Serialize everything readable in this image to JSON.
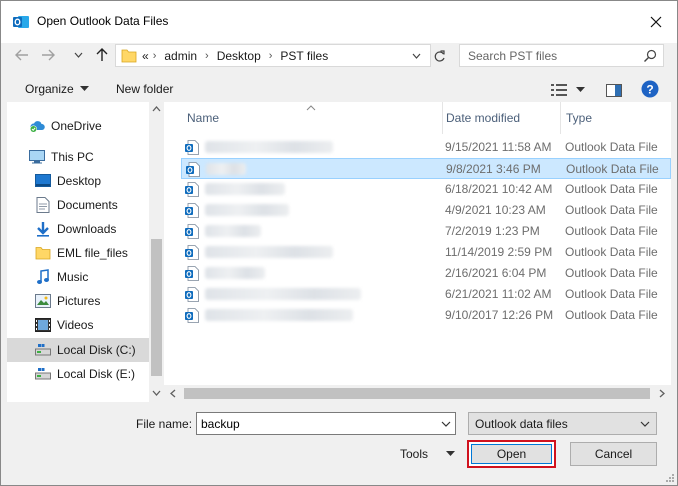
{
  "window": {
    "title": "Open Outlook Data Files",
    "app_icon": "outlook-icon",
    "close_icon": "close-icon"
  },
  "navigation": {
    "back_icon": "arrow-left-icon",
    "forward_icon": "arrow-right-icon",
    "recent_icon": "chevron-down-icon",
    "up_icon": "arrow-up-icon"
  },
  "addressbar": {
    "overflow": "«",
    "crumbs": [
      "admin",
      "Desktop",
      "PST files"
    ],
    "separator": "›"
  },
  "search": {
    "placeholder": "Search PST files",
    "icon": "search-icon"
  },
  "toolbar": {
    "organize_label": "Organize",
    "new_folder_label": "New folder",
    "view_icon": "details-view-icon",
    "preview_icon": "preview-pane-icon",
    "help_icon": "help-icon"
  },
  "sidebar": {
    "items": [
      {
        "label": "OneDrive",
        "icon": "onedrive-icon",
        "selected": false
      },
      {
        "label": "This PC",
        "icon": "computer-icon",
        "selected": false
      },
      {
        "label": "Desktop",
        "icon": "desktop-icon",
        "selected": false
      },
      {
        "label": "Documents",
        "icon": "documents-icon",
        "selected": false
      },
      {
        "label": "Downloads",
        "icon": "downloads-icon",
        "selected": false
      },
      {
        "label": "EML file_files",
        "icon": "folder-icon",
        "selected": false
      },
      {
        "label": "Music",
        "icon": "music-icon",
        "selected": false
      },
      {
        "label": "Pictures",
        "icon": "pictures-icon",
        "selected": false
      },
      {
        "label": "Videos",
        "icon": "videos-icon",
        "selected": false
      },
      {
        "label": "Local Disk (C:)",
        "icon": "drive-icon",
        "selected": true
      },
      {
        "label": "Local Disk (E:)",
        "icon": "drive-icon",
        "selected": false
      }
    ]
  },
  "filelist": {
    "columns": [
      "Name",
      "Date modified",
      "Type"
    ],
    "sort_column": "Name",
    "rows": [
      {
        "date": "9/15/2021 11:58 AM",
        "type": "Outlook Data File",
        "selected": false
      },
      {
        "date": "9/8/2021 3:46 PM",
        "type": "Outlook Data File",
        "selected": true
      },
      {
        "date": "6/18/2021 10:42 AM",
        "type": "Outlook Data File",
        "selected": false
      },
      {
        "date": "4/9/2021 10:23 AM",
        "type": "Outlook Data File",
        "selected": false
      },
      {
        "date": "7/2/2019 1:23 PM",
        "type": "Outlook Data File",
        "selected": false
      },
      {
        "date": "11/14/2019 2:59 PM",
        "type": "Outlook Data File",
        "selected": false
      },
      {
        "date": "2/16/2021 6:04 PM",
        "type": "Outlook Data File",
        "selected": false
      },
      {
        "date": "6/21/2021 11:02 AM",
        "type": "Outlook Data File",
        "selected": false
      },
      {
        "date": "9/10/2017 12:26 PM",
        "type": "Outlook Data File",
        "selected": false
      }
    ]
  },
  "footer": {
    "filename_label": "File name:",
    "filename_value": "backup",
    "filter_value": "Outlook data files",
    "tools_label": "Tools",
    "open_label": "Open",
    "cancel_label": "Cancel"
  },
  "colors": {
    "highlight": "#d0121e",
    "selection": "#cce8ff",
    "outlook_blue": "#0f6cbd"
  }
}
